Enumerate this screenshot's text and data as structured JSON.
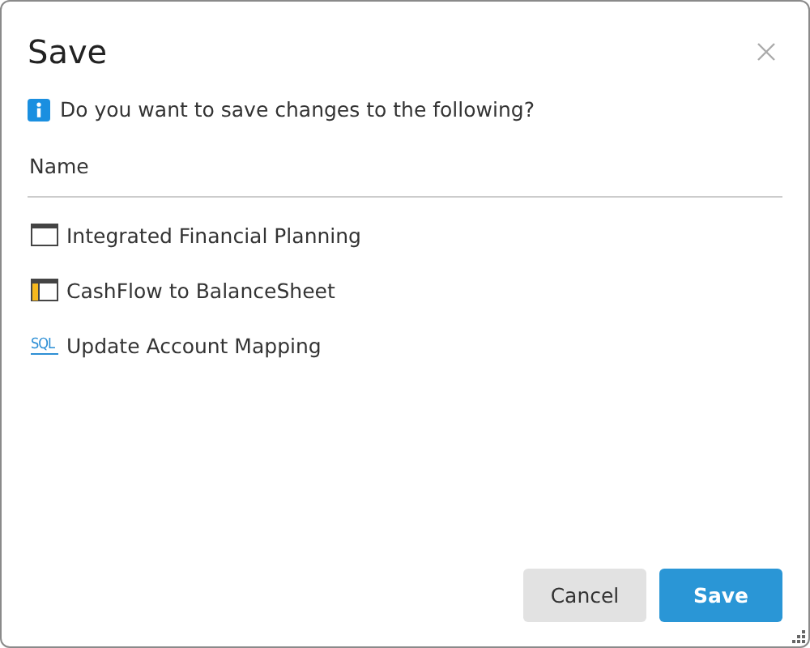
{
  "dialog": {
    "title": "Save",
    "message": "Do you want to save changes to the following?"
  },
  "list": {
    "column": "Name",
    "items": [
      {
        "kind": "view",
        "label": "Integrated Financial Planning"
      },
      {
        "kind": "sheet",
        "label": "CashFlow to BalanceSheet"
      },
      {
        "kind": "sql",
        "icon_text": "SQL",
        "label": "Update Account Mapping"
      }
    ]
  },
  "buttons": [
    {
      "kind": "secondary",
      "label": "Cancel"
    },
    {
      "kind": "primary",
      "label": "Save"
    }
  ]
}
